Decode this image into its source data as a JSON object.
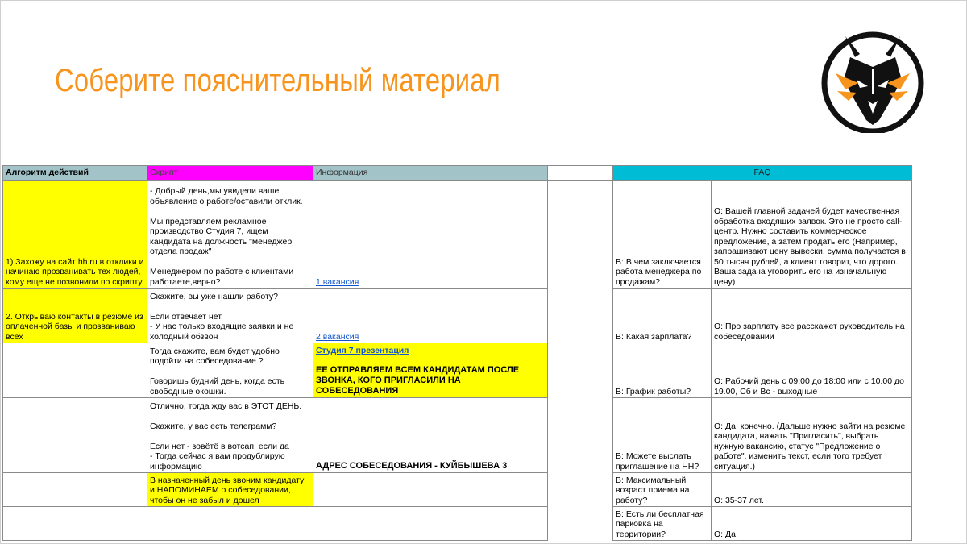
{
  "title": "Соберите пояснительный материал",
  "colors": {
    "title": "#f7941d",
    "yellow": "#ffff00",
    "magenta": "#ff00ff",
    "teal": "#a2c4c9",
    "cyan": "#00bcd4"
  },
  "table": {
    "headers": {
      "algorithm": "Алгоритм действий",
      "script": "Скрипт",
      "info": "Информация",
      "faq": "FAQ"
    },
    "rows": [
      {
        "algorithm": "1) Захожу на сайт hh.ru в отклики и начинаю прозванивать тех людей, кому еще не позвонили по скрипту",
        "script": "- Добрый день,мы увидели ваше объявление о работе/оставили отклик.\n\nМы представляем рекламное производство Студия 7, ищем кандидата на должность \"менеджер отдела продаж\"\n\nМенеджером по работе с клиентами работаете,верно?",
        "info": "1 вакансия",
        "question": "В: В чем заключается работа менеджера по продажам?",
        "answer": "О: Вашей главной задачей будет качественная обработка входящих заявок. Это не просто call-центр. Нужно составить коммерческое предложение, а затем продать его (Например, запрашивают цену вывески, сумма получается в 50 тысяч рублей, а клиент говорит, что дорого. Ваша задача уговорить его на изначальную цену)"
      },
      {
        "algorithm": "2. Открываю контакты в резюме из оплаченной базы и прозваниваю всех",
        "script": "Скажите, вы уже нашли работу?\n\nЕсли отвечает нет\n-   У нас только входящие заявки и не холодный обзвон",
        "info": "2 вакансия",
        "question": "В: Какая зарплата?",
        "answer": "О: Про зарплату все расскажет руководитель на собеседовании"
      },
      {
        "algorithm": "",
        "script": "Тогда скажите, вам будет удобно подойти на собеседование ?\n\nГоворишь будний день, когда есть свободные окошки.",
        "info_link": "Студия 7 презентация",
        "info_note": "ЕЕ ОТПРАВЛЯЕМ ВСЕМ КАНДИДАТАМ ПОСЛЕ ЗВОНКА, КОГО ПРИГЛАСИЛИ НА СОБЕСЕДОВАНИЯ",
        "question": "В: График работы?",
        "answer": "О: Рабочий день с 09:00 до 18:00 или с 10.00 до 19.00, Сб и Вс - выходные"
      },
      {
        "algorithm": "",
        "script": "Отлично, тогда жду вас в ЭТОТ ДЕНЬ.\n\nСкажите, у вас есть телеграмм?\n\nЕсли нет - зовётё в вотсап, если да\n- Тогда сейчас я вам продублирую информацию",
        "info": "АДРЕС СОБЕСЕДОВАНИЯ - КУЙБЫШЕВА 3",
        "question": "В: Можете выслать приглашение на НН?",
        "answer": "О: Да, конечно. (Дальше нужно зайти на резюме кандидата, нажать \"Пригласить\", выбрать нужную вакансию, статус \"Предложение о работе\", изменить текст, если того требует ситуация.)"
      },
      {
        "algorithm": "",
        "script": "В назначенный день звоним кандидату и НАПОМИНАЕМ о собеседовании, чтобы он не забыл и дошел",
        "info": "",
        "question": "В: Максимальный возраст приема на работу?",
        "answer": "О: 35-37 лет."
      },
      {
        "algorithm": "",
        "script": "",
        "info": "",
        "question": "В: Есть ли бесплатная парковка на территории?",
        "answer": "О: Да."
      }
    ]
  }
}
